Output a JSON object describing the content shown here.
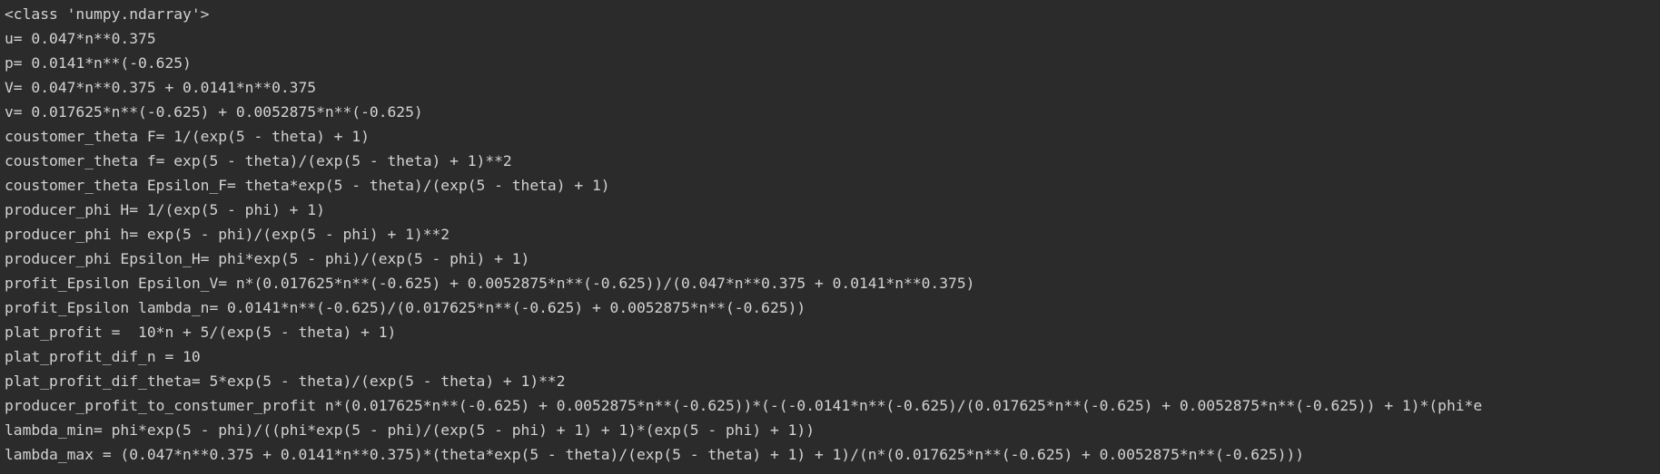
{
  "console": {
    "lines": [
      "<class 'numpy.ndarray'>",
      "u= 0.047*n**0.375",
      "p= 0.0141*n**(-0.625)",
      "V= 0.047*n**0.375 + 0.0141*n**0.375",
      "v= 0.017625*n**(-0.625) + 0.0052875*n**(-0.625)",
      "coustomer_theta F= 1/(exp(5 - theta) + 1)",
      "coustomer_theta f= exp(5 - theta)/(exp(5 - theta) + 1)**2",
      "coustomer_theta Epsilon_F= theta*exp(5 - theta)/(exp(5 - theta) + 1)",
      "producer_phi H= 1/(exp(5 - phi) + 1)",
      "producer_phi h= exp(5 - phi)/(exp(5 - phi) + 1)**2",
      "producer_phi Epsilon_H= phi*exp(5 - phi)/(exp(5 - phi) + 1)",
      "profit_Epsilon Epsilon_V= n*(0.017625*n**(-0.625) + 0.0052875*n**(-0.625))/(0.047*n**0.375 + 0.0141*n**0.375)",
      "profit_Epsilon lambda_n= 0.0141*n**(-0.625)/(0.017625*n**(-0.625) + 0.0052875*n**(-0.625))",
      "plat_profit =  10*n + 5/(exp(5 - theta) + 1)",
      "plat_profit_dif_n = 10",
      "plat_profit_dif_theta= 5*exp(5 - theta)/(exp(5 - theta) + 1)**2",
      "producer_profit_to_constumer_profit n*(0.017625*n**(-0.625) + 0.0052875*n**(-0.625))*(-(-0.0141*n**(-0.625)/(0.017625*n**(-0.625) + 0.0052875*n**(-0.625)) + 1)*(phi*e",
      "lambda_min= phi*exp(5 - phi)/((phi*exp(5 - phi)/(exp(5 - phi) + 1) + 1)*(exp(5 - phi) + 1))",
      "lambda_max = (0.047*n**0.375 + 0.0141*n**0.375)*(theta*exp(5 - theta)/(exp(5 - theta) + 1) + 1)/(n*(0.017625*n**(-0.625) + 0.0052875*n**(-0.625)))"
    ]
  },
  "colors": {
    "background": "#2b2b2b",
    "text": "#d2d2d2"
  }
}
